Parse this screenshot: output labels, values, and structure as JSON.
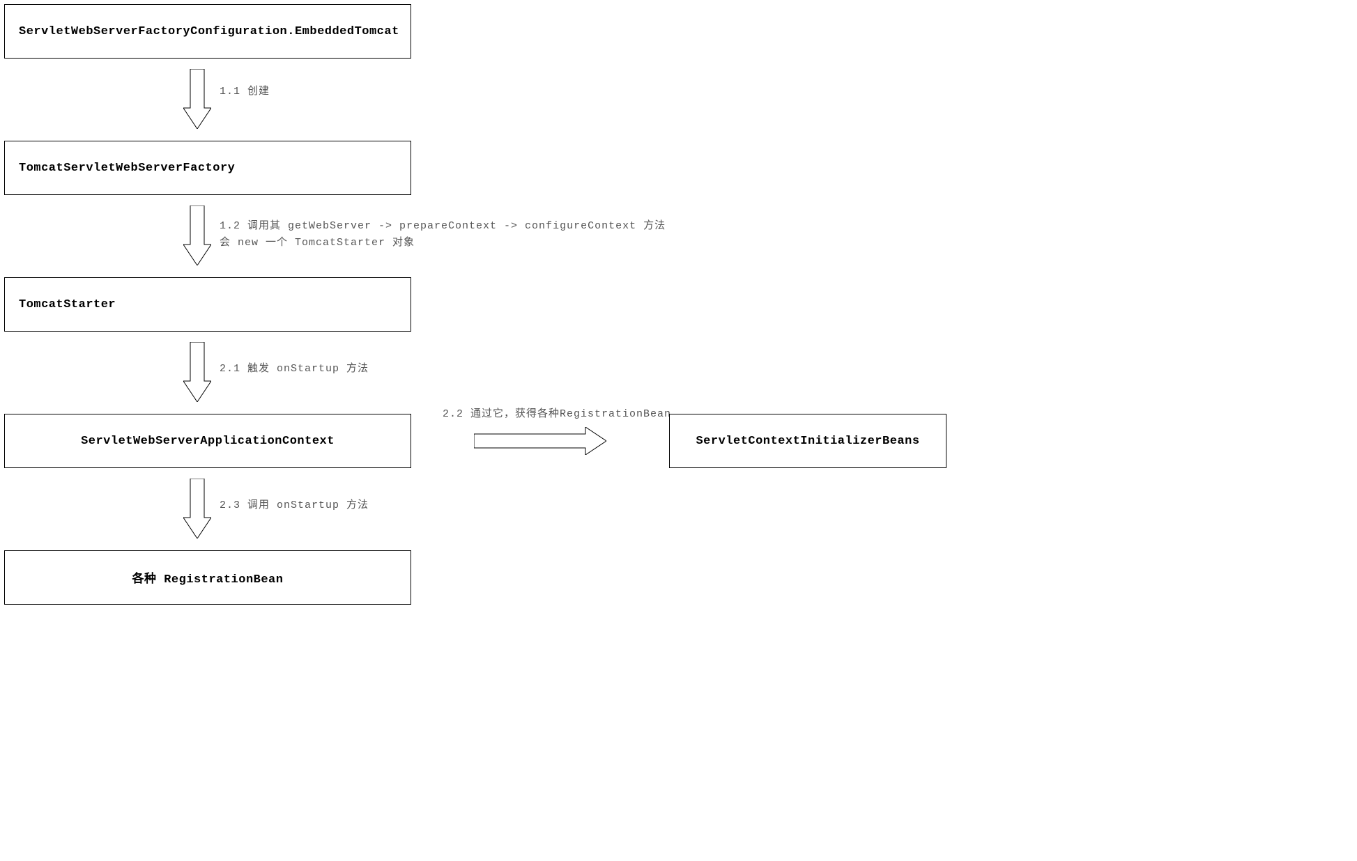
{
  "boxes": {
    "box1": "ServletWebServerFactoryConfiguration.EmbeddedTomcat",
    "box2": "TomcatServletWebServerFactory",
    "box3": "TomcatStarter",
    "box4": "ServletWebServerApplicationContext",
    "box5": "各种 RegistrationBean",
    "box6": "ServletContextInitializerBeans"
  },
  "labels": {
    "label1": "1.1 创建",
    "label2a": "1.2 调用其 getWebServer -> prepareContext -> configureContext 方法",
    "label2b": "会 new 一个 TomcatStarter 对象",
    "label3": "2.1 触发 onStartup 方法",
    "label4": "2.2 通过它，获得各种RegistrationBean",
    "label5": "2.3 调用 onStartup 方法"
  }
}
